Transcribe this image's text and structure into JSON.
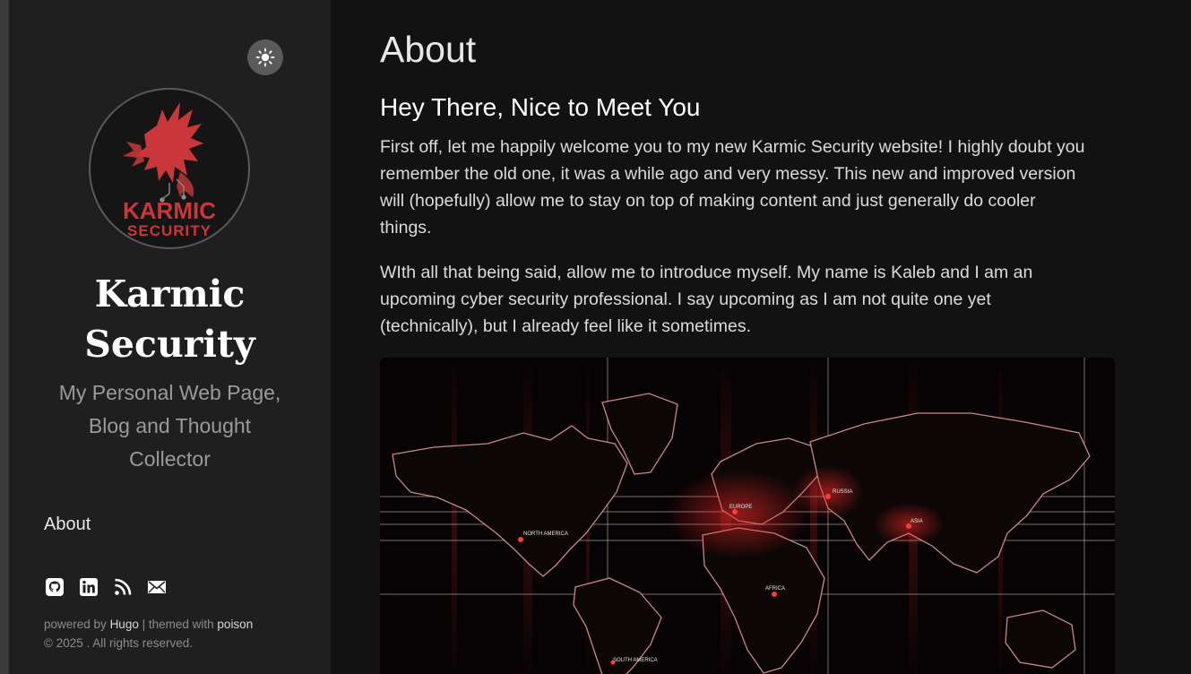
{
  "sidebar": {
    "theme_toggle_icon": "sun-icon",
    "logo": {
      "brand_line1": "KARMIC",
      "brand_line2": "SECURITY",
      "accent_color": "#c9373a"
    },
    "site_title_line1": "Karmic",
    "site_title_line2": "Security",
    "tagline_line1": "My Personal Web Page,",
    "tagline_line2": "Blog and Thought",
    "tagline_line3": "Collector",
    "nav": [
      {
        "label": "About"
      }
    ],
    "social_icons": [
      "github-icon",
      "linkedin-icon",
      "rss-icon",
      "email-icon"
    ],
    "footer": {
      "powered_by": "powered by",
      "hugo": "Hugo",
      "themed_with": "| themed with",
      "poison": "poison",
      "copyright": "© 2025 . All rights reserved."
    }
  },
  "main": {
    "title": "About",
    "heading": "Hey There, Nice to Meet You",
    "paragraph1_lines": [
      "First off, let me happily welcome you to my new Karmic Security website! I highly doubt you",
      "remember the old one, it was a while ago and very messy. This new and improved version",
      "will (hopefully) allow me to stay on top of making content and just generally do cooler",
      "things."
    ],
    "paragraph2_lines": [
      "WIth all that being said, allow me to introduce myself. My name is Kaleb and I am an",
      "upcoming cyber security professional. I say upcoming as I am not quite one yet",
      "(technically), but I already feel like it sometimes."
    ],
    "map_labels": {
      "north_america": "NORTH AMERICA",
      "europe": "EUROPE",
      "asia": "ASIA",
      "africa": "AFRICA",
      "south_america": "SOUTH AMERICA",
      "russia": "RUSSIA"
    }
  }
}
